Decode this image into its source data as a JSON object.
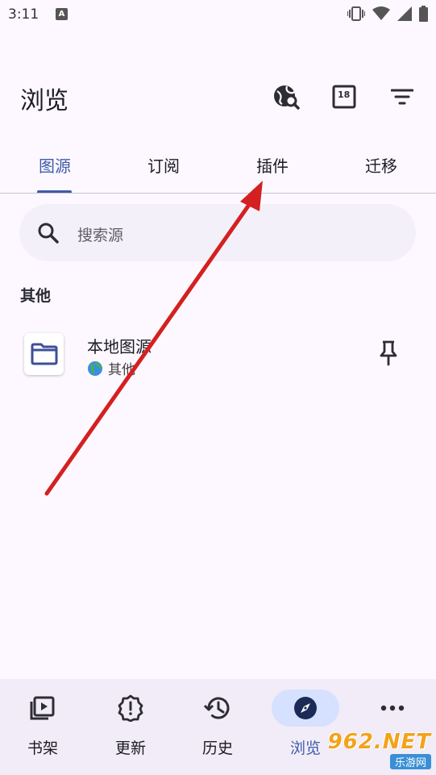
{
  "status_bar": {
    "time": "3:11",
    "notification_glyph": "A",
    "icons": [
      "vibrate-icon",
      "wifi-icon",
      "signal-icon",
      "battery-icon"
    ]
  },
  "header": {
    "title": "浏览",
    "actions": [
      "global-search-icon",
      "nsfw-18-icon",
      "filter-icon"
    ],
    "badge_18": "18"
  },
  "tabs": {
    "items": [
      {
        "label": "图源",
        "active": true
      },
      {
        "label": "订阅",
        "active": false
      },
      {
        "label": "插件",
        "active": false
      },
      {
        "label": "迁移",
        "active": false
      }
    ]
  },
  "search": {
    "placeholder": "搜索源"
  },
  "sections": [
    {
      "label": "其他",
      "sources": [
        {
          "name": "本地图源",
          "language": "其他",
          "icon": "folder-icon",
          "pinned": false
        }
      ]
    }
  ],
  "bottom_nav": {
    "items": [
      {
        "label": "书架",
        "icon": "library-icon",
        "active": false
      },
      {
        "label": "更新",
        "icon": "updates-icon",
        "active": false
      },
      {
        "label": "历史",
        "icon": "history-icon",
        "active": false
      },
      {
        "label": "浏览",
        "icon": "explore-icon",
        "active": true
      },
      {
        "label": "",
        "icon": "more-icon",
        "active": false
      }
    ]
  },
  "watermark": {
    "number": "962.NET",
    "sub": "乐游网"
  },
  "colors": {
    "accent": "#3e5ba9",
    "background": "#fdf8ff",
    "annotation_arrow": "#d42020"
  }
}
